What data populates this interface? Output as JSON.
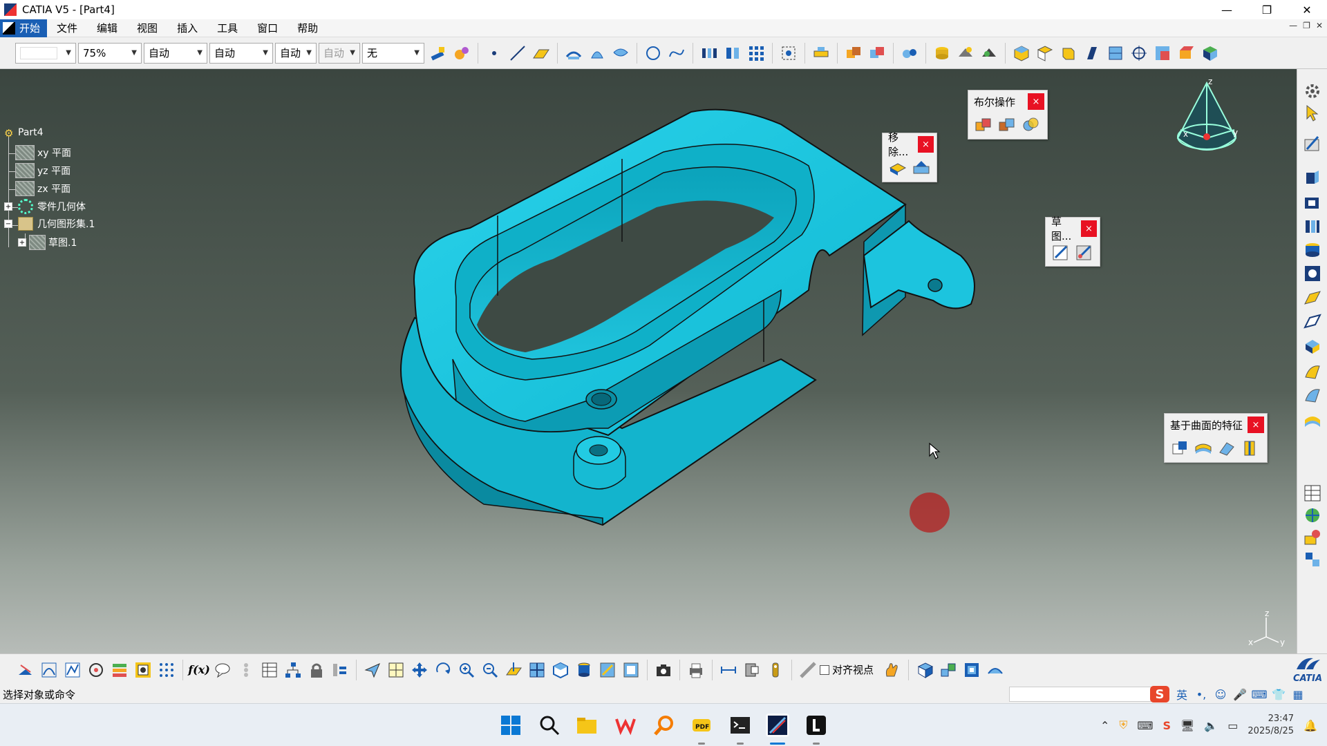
{
  "window": {
    "title": "CATIA V5 - [Part4]",
    "controls": {
      "minimize": "—",
      "restore": "❐",
      "close": "✕"
    }
  },
  "menubar": {
    "start": "开始",
    "items": [
      "文件",
      "编辑",
      "视图",
      "插入",
      "工具",
      "窗口",
      "帮助"
    ]
  },
  "toolbar": {
    "color_combo": "",
    "transparency_combo": "75%",
    "thickness_combo": "自动",
    "linetype_combo": "自动",
    "pointtype_combo": "自动",
    "layer_combo_disabled": "自动",
    "render_combo": "无"
  },
  "spec_tree": {
    "root": "Part4",
    "xy_plane": "xy 平面",
    "yz_plane": "yz 平面",
    "zx_plane": "zx 平面",
    "part_body": "零件几何体",
    "geo_set": "几何图形集.1",
    "sketch": "草图.1"
  },
  "floating_toolbars": {
    "boolean": "布尔操作",
    "remove": "移除...",
    "sketch": "草图...",
    "surface_features": "基于曲面的特征",
    "close": "×"
  },
  "compass": {
    "x": "x",
    "y": "y",
    "z": "z"
  },
  "axis_triad": {
    "x": "x",
    "y": "y",
    "z": "z"
  },
  "bottom_toolbar": {
    "align_viewpoint": "对齐视点",
    "logo": "CATIA"
  },
  "status": {
    "message": "选择对象或命令",
    "ime_lang": "英"
  },
  "taskbar": {
    "time": "23:47",
    "date": "2025/8/25"
  },
  "colors": {
    "part": "#19c7df",
    "part_dark": "#0e8fa3",
    "accent_blue": "#1a5fb4"
  }
}
